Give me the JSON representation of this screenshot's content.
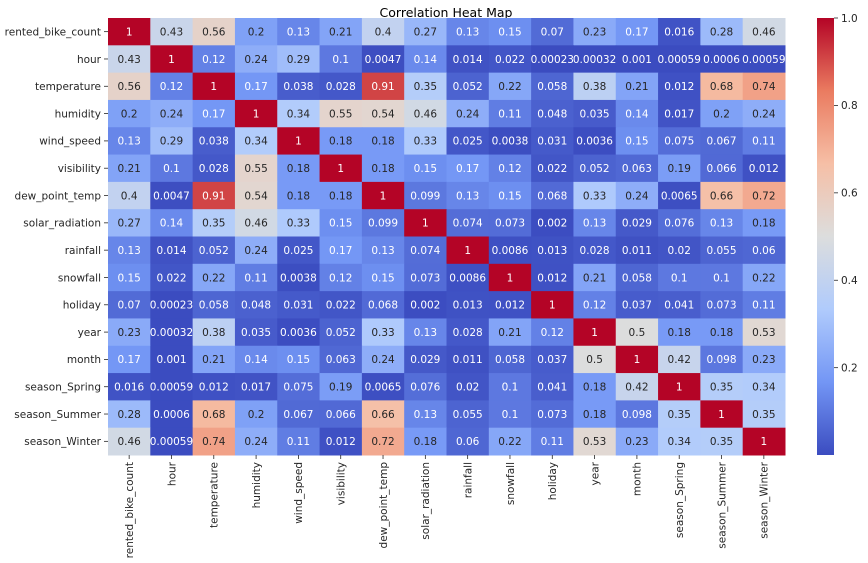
{
  "chart_data": {
    "type": "heatmap",
    "title": "Correlation Heat Map",
    "xlabel": "",
    "ylabel": "",
    "colormap": "coolwarm",
    "colormap_stops": [
      "#3b4cc0",
      "#7396f5",
      "#b0cbfc",
      "#dcdddd",
      "#f6bfa6",
      "#ea7b60",
      "#b40426"
    ],
    "value_range": [
      0.00023,
      1.0
    ],
    "colorbar": {
      "ticks": [
        0.2,
        0.4,
        0.6,
        0.8,
        1.0
      ],
      "tick_labels": [
        "0.2",
        "0.4",
        "0.6",
        "0.8",
        "1.0"
      ],
      "placement": "right"
    },
    "annot_text_dark": "#262626",
    "annot_text_light": "#ffffff",
    "labels": [
      "rented_bike_count",
      "hour",
      "temperature",
      "humidity",
      "wind_speed",
      "visibility",
      "dew_point_temp",
      "solar_radiation",
      "rainfall",
      "snowfall",
      "holiday",
      "year",
      "month",
      "season_Spring",
      "season_Summer",
      "season_Winter"
    ],
    "matrix": [
      [
        1,
        0.43,
        0.56,
        0.2,
        0.13,
        0.21,
        0.4,
        0.27,
        0.13,
        0.15,
        0.07,
        0.23,
        0.17,
        0.016,
        0.28,
        0.46
      ],
      [
        0.43,
        1,
        0.12,
        0.24,
        0.29,
        0.1,
        0.0047,
        0.14,
        0.014,
        0.022,
        0.00023,
        0.00032,
        0.001,
        0.00059,
        0.0006,
        0.00059
      ],
      [
        0.56,
        0.12,
        1,
        0.17,
        0.038,
        0.028,
        0.91,
        0.35,
        0.052,
        0.22,
        0.058,
        0.38,
        0.21,
        0.012,
        0.68,
        0.74
      ],
      [
        0.2,
        0.24,
        0.17,
        1,
        0.34,
        0.55,
        0.54,
        0.46,
        0.24,
        0.11,
        0.048,
        0.035,
        0.14,
        0.017,
        0.2,
        0.24
      ],
      [
        0.13,
        0.29,
        0.038,
        0.34,
        1,
        0.18,
        0.18,
        0.33,
        0.025,
        0.0038,
        0.031,
        0.0036,
        0.15,
        0.075,
        0.067,
        0.11
      ],
      [
        0.21,
        0.1,
        0.028,
        0.55,
        0.18,
        1,
        0.18,
        0.15,
        0.17,
        0.12,
        0.022,
        0.052,
        0.063,
        0.19,
        0.066,
        0.012
      ],
      [
        0.4,
        0.0047,
        0.91,
        0.54,
        0.18,
        0.18,
        1,
        0.099,
        0.13,
        0.15,
        0.068,
        0.33,
        0.24,
        0.0065,
        0.66,
        0.72
      ],
      [
        0.27,
        0.14,
        0.35,
        0.46,
        0.33,
        0.15,
        0.099,
        1,
        0.074,
        0.073,
        0.002,
        0.13,
        0.029,
        0.076,
        0.13,
        0.18
      ],
      [
        0.13,
        0.014,
        0.052,
        0.24,
        0.025,
        0.17,
        0.13,
        0.074,
        1,
        0.0086,
        0.013,
        0.028,
        0.011,
        0.02,
        0.055,
        0.06
      ],
      [
        0.15,
        0.022,
        0.22,
        0.11,
        0.0038,
        0.12,
        0.15,
        0.073,
        0.0086,
        1,
        0.012,
        0.21,
        0.058,
        0.1,
        0.1,
        0.22
      ],
      [
        0.07,
        0.00023,
        0.058,
        0.048,
        0.031,
        0.022,
        0.068,
        0.002,
        0.013,
        0.012,
        1,
        0.12,
        0.037,
        0.041,
        0.073,
        0.11
      ],
      [
        0.23,
        0.00032,
        0.38,
        0.035,
        0.0036,
        0.052,
        0.33,
        0.13,
        0.028,
        0.21,
        0.12,
        1,
        0.5,
        0.18,
        0.18,
        0.53
      ],
      [
        0.17,
        0.001,
        0.21,
        0.14,
        0.15,
        0.063,
        0.24,
        0.029,
        0.011,
        0.058,
        0.037,
        0.5,
        1,
        0.42,
        0.098,
        0.23
      ],
      [
        0.016,
        0.00059,
        0.012,
        0.017,
        0.075,
        0.19,
        0.0065,
        0.076,
        0.02,
        0.1,
        0.041,
        0.18,
        0.42,
        1,
        0.35,
        0.34
      ],
      [
        0.28,
        0.0006,
        0.68,
        0.2,
        0.067,
        0.066,
        0.66,
        0.13,
        0.055,
        0.1,
        0.073,
        0.18,
        0.098,
        0.35,
        1,
        0.35
      ],
      [
        0.46,
        0.00059,
        0.74,
        0.24,
        0.11,
        0.012,
        0.72,
        0.18,
        0.06,
        0.22,
        0.11,
        0.53,
        0.23,
        0.34,
        0.35,
        1
      ]
    ]
  }
}
